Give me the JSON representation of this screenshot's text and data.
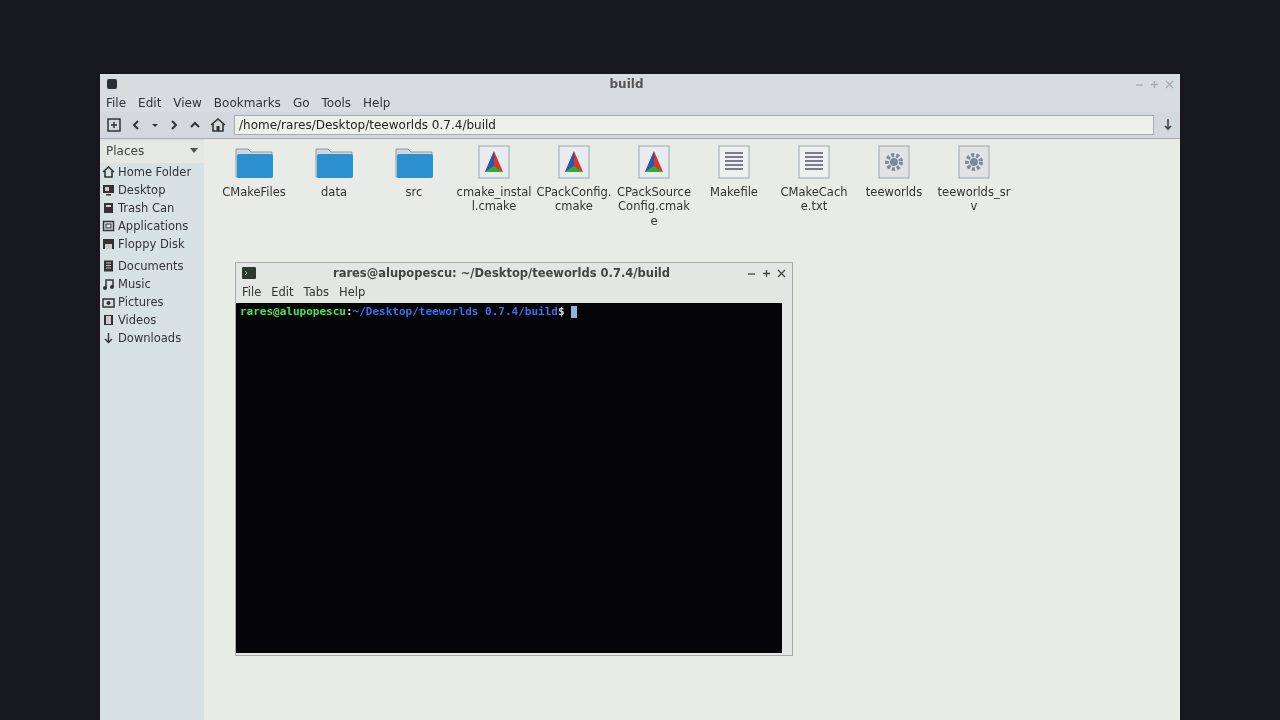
{
  "window": {
    "title": "build"
  },
  "menu": [
    "File",
    "Edit",
    "View",
    "Bookmarks",
    "Go",
    "Tools",
    "Help"
  ],
  "location": {
    "value": "/home/rares/Desktop/teeworlds 0.7.4/build"
  },
  "sidebar": {
    "header": "Places",
    "items": [
      {
        "label": "Home Folder",
        "kind": "home"
      },
      {
        "label": "Desktop",
        "kind": "desktop"
      },
      {
        "label": "Trash Can",
        "kind": "trash"
      },
      {
        "label": "Applications",
        "kind": "apps"
      },
      {
        "label": "Floppy Disk",
        "kind": "floppy"
      },
      {
        "label": "Documents",
        "kind": "documents"
      },
      {
        "label": "Music",
        "kind": "music"
      },
      {
        "label": "Pictures",
        "kind": "pictures"
      },
      {
        "label": "Videos",
        "kind": "videos"
      },
      {
        "label": "Downloads",
        "kind": "downloads"
      }
    ]
  },
  "files": [
    {
      "name": "CMakeFiles",
      "kind": "folder"
    },
    {
      "name": "data",
      "kind": "folder"
    },
    {
      "name": "src",
      "kind": "folder"
    },
    {
      "name": "cmake_install.cmake",
      "kind": "cmake"
    },
    {
      "name": "CPackConfig.cmake",
      "kind": "cmake"
    },
    {
      "name": "CPackSourceConfig.cmake",
      "kind": "cmake"
    },
    {
      "name": "Makefile",
      "kind": "text"
    },
    {
      "name": "CMakeCache.txt",
      "kind": "text"
    },
    {
      "name": "teeworlds",
      "kind": "executable"
    },
    {
      "name": "teeworlds_srv",
      "kind": "executable"
    }
  ],
  "terminal": {
    "title": "rares@alupopescu: ~/Desktop/teeworlds 0.7.4/build",
    "menu": [
      "File",
      "Edit",
      "Tabs",
      "Help"
    ],
    "prompt": {
      "user_host": "rares@alupopescu",
      "separator": ":",
      "path": "~/Desktop/teeworlds 0.7.4/build",
      "symbol": "$"
    }
  }
}
